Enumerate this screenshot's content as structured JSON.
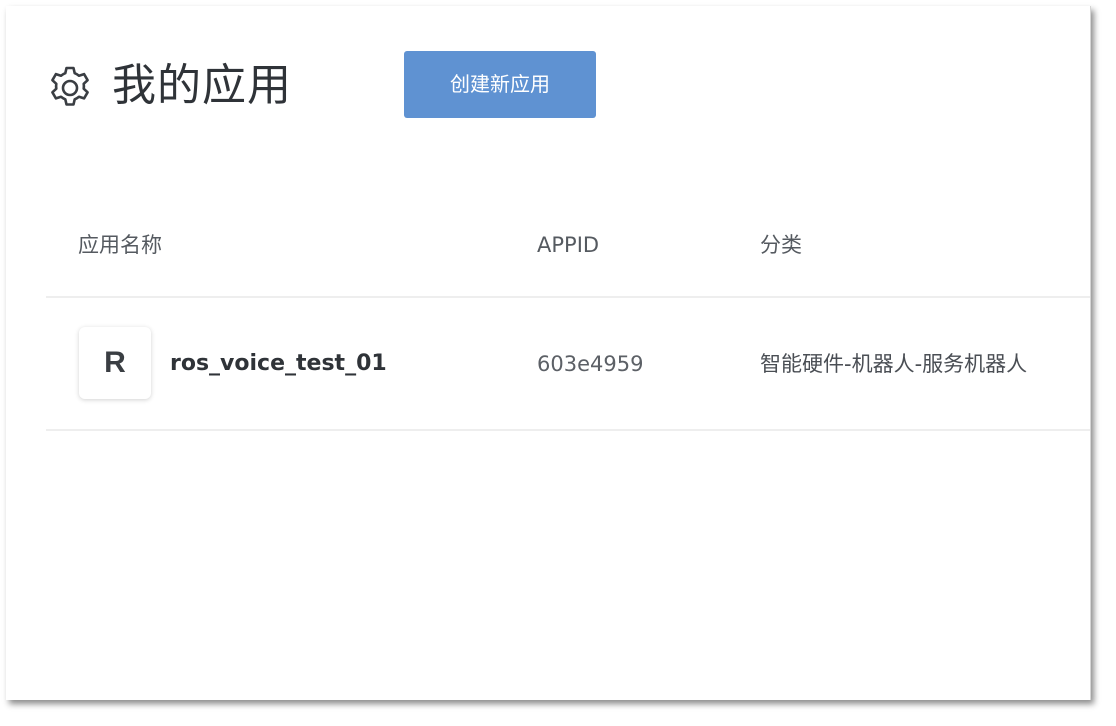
{
  "header": {
    "icon": "gear-icon",
    "title": "我的应用",
    "create_button_label": "创建新应用"
  },
  "colors": {
    "accent": "#5f92d2",
    "text_dark": "#2f3338",
    "text_muted": "#5c6066",
    "divider": "#eeeeee"
  },
  "table": {
    "columns": [
      "应用名称",
      "APPID",
      "分类"
    ],
    "rows": [
      {
        "avatar_letter": "R",
        "name": "ros_voice_test_01",
        "appid": "603e4959",
        "category": "智能硬件-机器人-服务机器人"
      }
    ]
  }
}
